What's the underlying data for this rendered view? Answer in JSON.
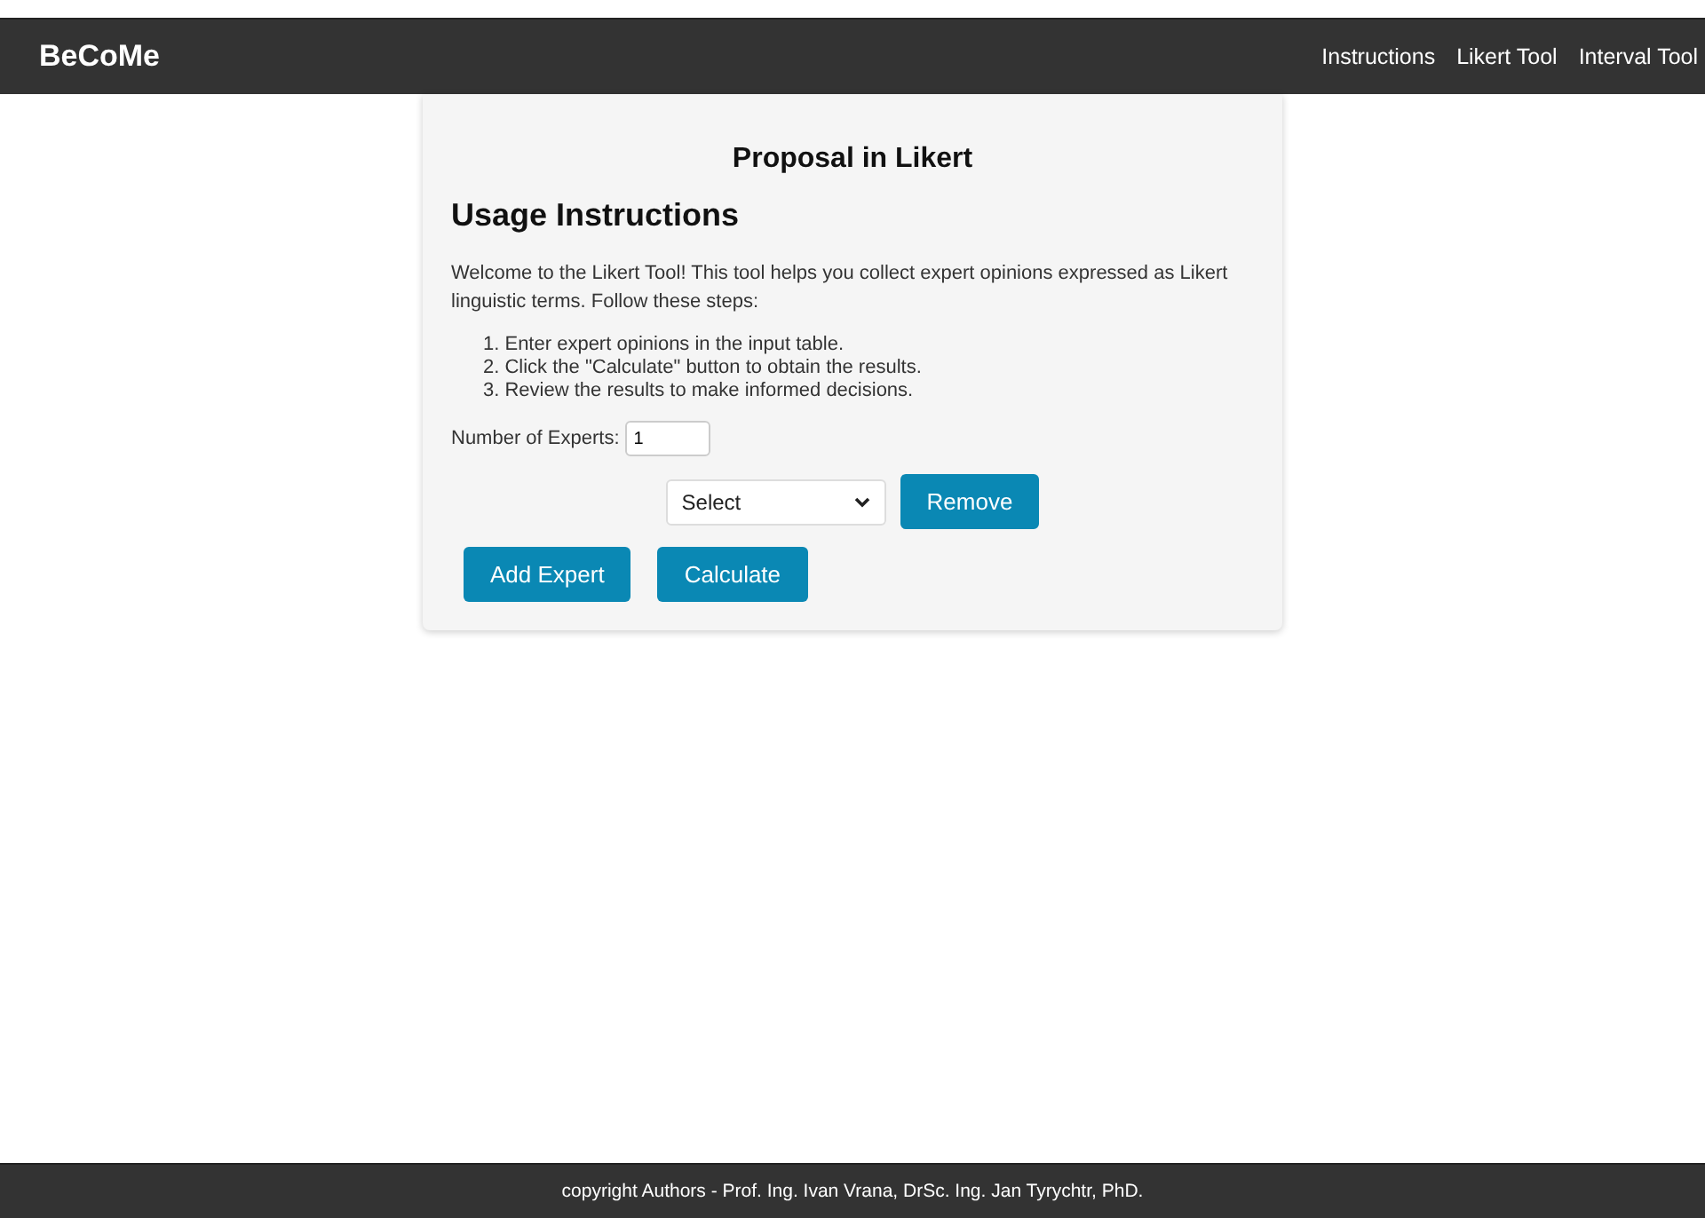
{
  "navbar": {
    "brand": "BeCoMe",
    "links": [
      "Instructions",
      "Likert Tool",
      "Interval Tool"
    ]
  },
  "card": {
    "title": "Proposal in Likert",
    "heading": "Usage Instructions",
    "intro": "Welcome to the Likert Tool! This tool helps you collect expert opinions expressed as Likert linguistic terms. Follow these steps:",
    "steps": [
      "1. Enter expert opinions in the input table.",
      "2. Click the \"Calculate\" button to obtain the results.",
      "3. Review the results to make informed decisions."
    ],
    "experts": {
      "label": "Number of Experts:",
      "value": "1"
    },
    "select": {
      "value": "Select"
    },
    "remove_button": "Remove",
    "buttons": [
      "Add Expert",
      "Calculate"
    ]
  },
  "footer": "copyright Authors - Prof. Ing. Ivan Vrana, DrSc. Ing. Jan Tyrychtr, PhD."
}
